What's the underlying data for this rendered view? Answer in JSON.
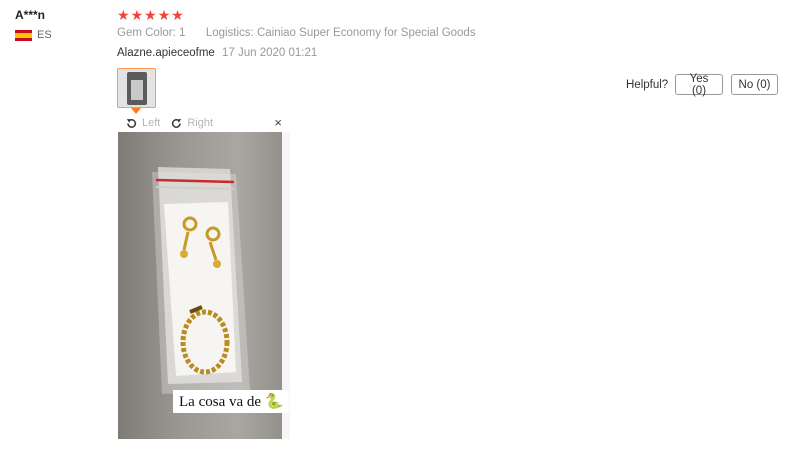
{
  "review": {
    "user_name": "A***n",
    "country_code": "ES",
    "rating": 5,
    "stars": [
      "★",
      "★",
      "★",
      "★",
      "★"
    ],
    "attributes": [
      {
        "label": "Gem Color:",
        "value": "1"
      },
      {
        "label": "Logistics:",
        "value": "Cainiao Super Economy for Special Goods"
      }
    ],
    "author": "Alazne.apieceofme",
    "date": "17 Jun 2020 01:21"
  },
  "helpful": {
    "label": "Helpful?",
    "yes": "Yes (0)",
    "no": "No (0)"
  },
  "viewer": {
    "rotate_left": "Left",
    "rotate_right": "Right",
    "close": "×",
    "caption": "La cosa va de 🐍"
  },
  "colors": {
    "star": "#f44336",
    "accent": "#ff7a1a",
    "muted_text": "#999999"
  }
}
